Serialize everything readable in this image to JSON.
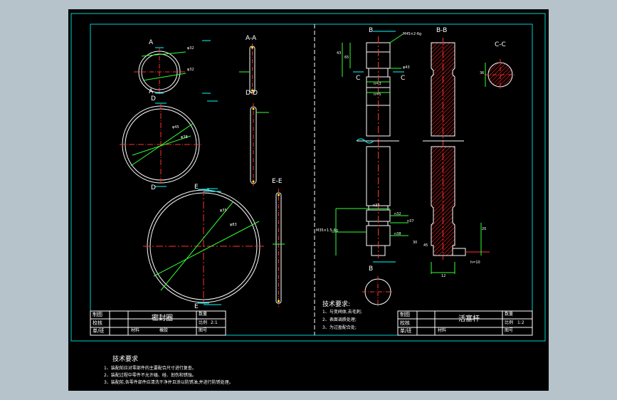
{
  "drawing": {
    "left_sheet": {
      "views": {
        "a": "A",
        "a_lower": "A",
        "d": "D",
        "d_lower": "D",
        "e": "E",
        "e_lower": "E",
        "aa": "A-A",
        "dd": "D-D",
        "ee": "E-E"
      },
      "dims": {
        "a_outer": "φ32",
        "a_inner": "φ32",
        "d_outer": "φ45",
        "d_inner": "φ38",
        "e_outer": "φ35",
        "e_inner": "φ83"
      },
      "title_block": {
        "drawn": "制图",
        "checked": "校核",
        "unit": "单/班",
        "name": "密封圈",
        "quantity": "数量",
        "scale_label": "比例",
        "scale_value": "2:1",
        "material_label": "材料",
        "material_value": "橡胶",
        "drawing_no_label": "图号"
      }
    },
    "right_sheet": {
      "views": {
        "b": "B",
        "b_lower": "B",
        "bb": "B-B",
        "c": "C",
        "c_right": "C",
        "cc": "C-C"
      },
      "dims": {
        "thread_top": "M45×2-6g",
        "h1": "43",
        "h2": "65",
        "chamfer": "φ43",
        "n3": "n=3",
        "n5": "n=5",
        "n37": "n37",
        "n32": "n32",
        "n37b": "n37",
        "n38": "n38",
        "thread_bottom": "M35×1.5-6g",
        "bottom_a": "30",
        "bottom_b": "45",
        "right_20": "20",
        "h10": "h=10",
        "w12": "12",
        "cc36": "36"
      },
      "tech": {
        "title": "技术要求:",
        "items": [
          "1、与变阀体,去毛刺;",
          "2、表面调质处理;",
          "3、为过盈配合处;"
        ]
      },
      "title_block": {
        "drawn": "制图",
        "checked": "校核",
        "unit": "单/班",
        "name": "活塞杆",
        "quantity": "数量",
        "scale_label": "比例",
        "scale_value": "1:2",
        "material_label": "材料",
        "drawing_no_label": "图号"
      }
    },
    "bottom_notes": {
      "title": "技术要求",
      "items": [
        "1、装配前应对零部件的主要配合尺寸进行复查。",
        "2、装配过程中零件不允许磕、碰、划伤和锈蚀。",
        "3、装配前,各零件部件应清洗干净并且涂以防锈油,并进行防锈处理。"
      ]
    }
  }
}
